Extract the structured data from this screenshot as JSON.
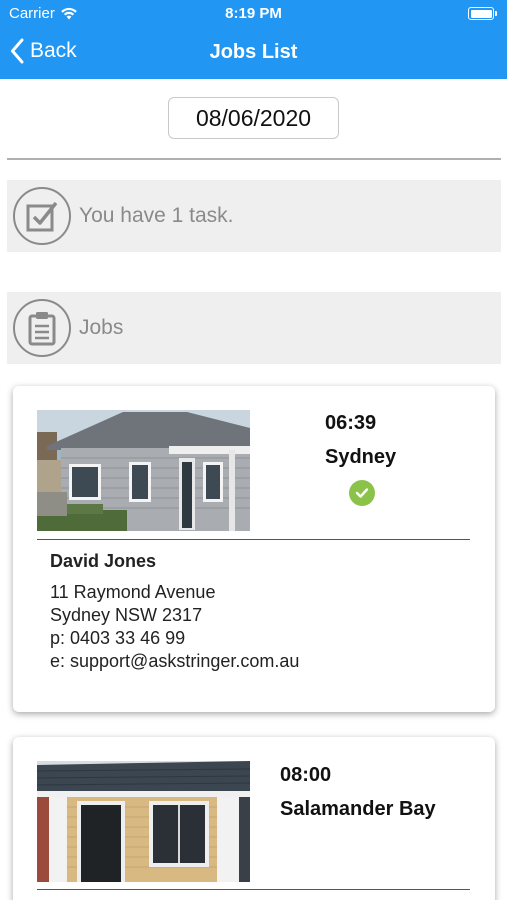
{
  "status_bar": {
    "carrier": "Carrier",
    "time": "8:19 PM"
  },
  "nav": {
    "back_label": "Back",
    "title": "Jobs List"
  },
  "date": {
    "value": "08/06/2020"
  },
  "task_summary": {
    "label": "You have 1 task."
  },
  "jobs_header": {
    "label": "Jobs"
  },
  "jobs": [
    {
      "time": "06:39",
      "location": "Sydney",
      "status": "completed",
      "contact_name": "David Jones",
      "address_line1": "11 Raymond Avenue",
      "address_line2": "Sydney NSW 2317",
      "phone": "p: 0403 33 46 99",
      "email": "e: support@askstringer.com.au"
    },
    {
      "time": "08:00",
      "location": "Salamander Bay"
    }
  ],
  "colors": {
    "header": "#2196f3",
    "status_ok": "#8bc34a",
    "row_bg": "#efefef"
  }
}
